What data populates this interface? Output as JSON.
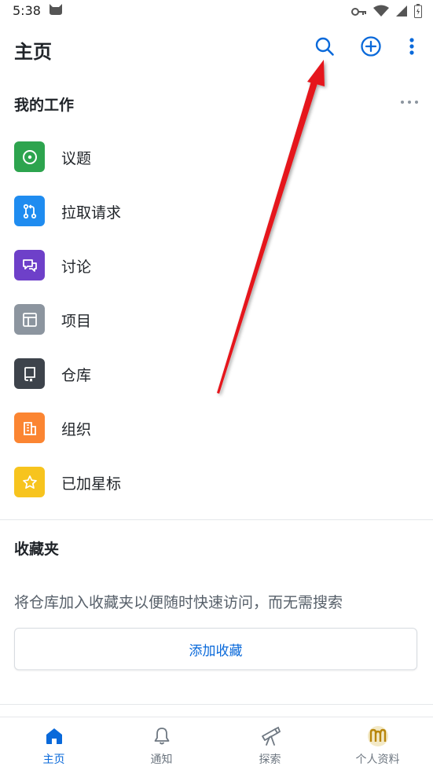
{
  "status": {
    "time": "5:38"
  },
  "header": {
    "title": "主页"
  },
  "my_work": {
    "title": "我的工作",
    "items": [
      {
        "label": "议题",
        "color": "#2da44e",
        "icon": "issue-icon"
      },
      {
        "label": "拉取请求",
        "color": "#1f8cf0",
        "icon": "pull-request-icon"
      },
      {
        "label": "讨论",
        "color": "#6e40c9",
        "icon": "discussion-icon"
      },
      {
        "label": "项目",
        "color": "#8c959f",
        "icon": "project-icon"
      },
      {
        "label": "仓库",
        "color": "#3d434b",
        "icon": "repo-icon"
      },
      {
        "label": "组织",
        "color": "#fb8532",
        "icon": "organization-icon"
      },
      {
        "label": "已加星标",
        "color": "#f7c41e",
        "icon": "star-icon"
      }
    ]
  },
  "favorites": {
    "title": "收藏夹",
    "description": "将仓库加入收藏夹以便随时快速访问，而无需搜索",
    "button": "添加收藏"
  },
  "bottom_nav": {
    "items": [
      {
        "label": "主页",
        "icon": "home-icon",
        "active": true
      },
      {
        "label": "通知",
        "icon": "bell-icon",
        "active": false
      },
      {
        "label": "探索",
        "icon": "telescope-icon",
        "active": false
      },
      {
        "label": "个人资料",
        "icon": "avatar-icon",
        "active": false
      }
    ]
  },
  "colors": {
    "accent": "#0969da",
    "annotation_arrow": "#e5161d"
  }
}
